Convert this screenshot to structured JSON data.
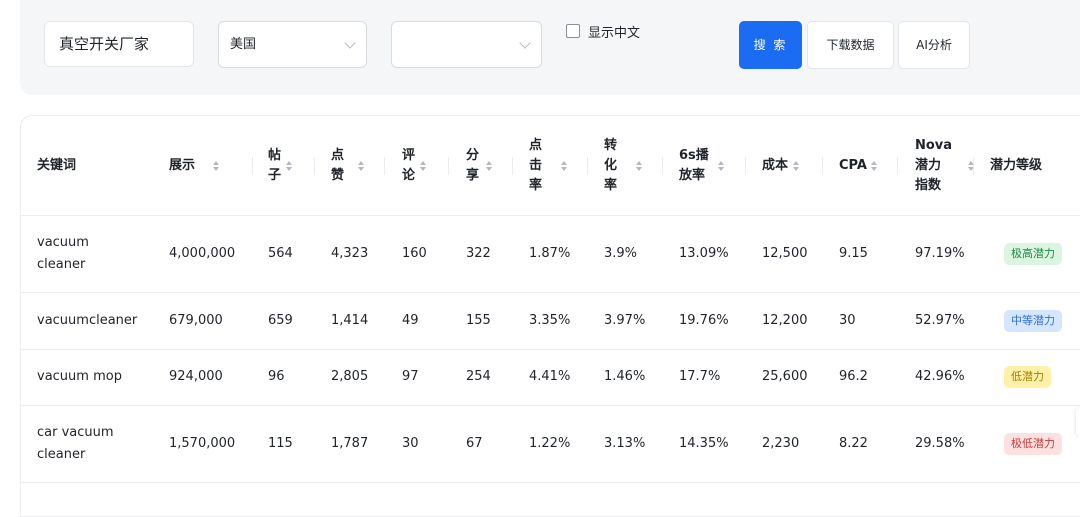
{
  "search": {
    "keyword": "真空开关厂家",
    "country": "美国",
    "second_select": "",
    "show_chinese_label": "显示中文",
    "search_label": "搜 索",
    "download_label": "下载数据",
    "ai_label": "AI分析"
  },
  "table": {
    "headers": {
      "keyword": "关键词",
      "impressions": "展示",
      "posts": [
        "帖",
        "子"
      ],
      "likes": [
        "点",
        "赞"
      ],
      "comments": [
        "评",
        "论"
      ],
      "shares": [
        "分",
        "享"
      ],
      "ctr": [
        "点",
        "击",
        "率"
      ],
      "cvr": [
        "转",
        "化",
        "率"
      ],
      "play6s": [
        "6s播",
        "放率"
      ],
      "cost": "成本",
      "cpa": "CPA",
      "nova": [
        "Nova",
        "潜力",
        "指数"
      ],
      "level": "潜力等级"
    },
    "rows": [
      {
        "keyword": [
          "vacuum",
          "cleaner"
        ],
        "impressions": "4,000,000",
        "posts": "564",
        "likes": "4,323",
        "comments": "160",
        "shares": "322",
        "ctr": "1.87%",
        "cvr": "3.9%",
        "play6s": "13.09%",
        "cost": "12,500",
        "cpa": "9.15",
        "nova": "97.19%",
        "level": "极高潜力",
        "level_type": "very-high"
      },
      {
        "keyword": [
          "vacuumcleaner"
        ],
        "impressions": "679,000",
        "posts": "659",
        "likes": "1,414",
        "comments": "49",
        "shares": "155",
        "ctr": "3.35%",
        "cvr": "3.97%",
        "play6s": "19.76%",
        "cost": "12,200",
        "cpa": "30",
        "nova": "52.97%",
        "level": "中等潜力",
        "level_type": "medium"
      },
      {
        "keyword": [
          "vacuum mop"
        ],
        "impressions": "924,000",
        "posts": "96",
        "likes": "2,805",
        "comments": "97",
        "shares": "254",
        "ctr": "4.41%",
        "cvr": "1.46%",
        "play6s": "17.7%",
        "cost": "25,600",
        "cpa": "96.2",
        "nova": "42.96%",
        "level": "低潜力",
        "level_type": "low"
      },
      {
        "keyword": [
          "car vacuum",
          "cleaner"
        ],
        "impressions": "1,570,000",
        "posts": "115",
        "likes": "1,787",
        "comments": "30",
        "shares": "67",
        "ctr": "1.22%",
        "cvr": "3.13%",
        "play6s": "14.35%",
        "cost": "2,230",
        "cpa": "8.22",
        "nova": "29.58%",
        "level": "极低潜力",
        "level_type": "very-low"
      }
    ]
  },
  "colors": {
    "primary": "#1b6cf2",
    "very-high": {
      "bg": "#dcf5e3",
      "fg": "#1f8a45"
    },
    "medium": {
      "bg": "#d6e6ff",
      "fg": "#2f6fd6"
    },
    "low": {
      "bg": "#fff2a8",
      "fg": "#a87a00"
    },
    "very-low": {
      "bg": "#fde1e1",
      "fg": "#cc3b3b"
    }
  }
}
